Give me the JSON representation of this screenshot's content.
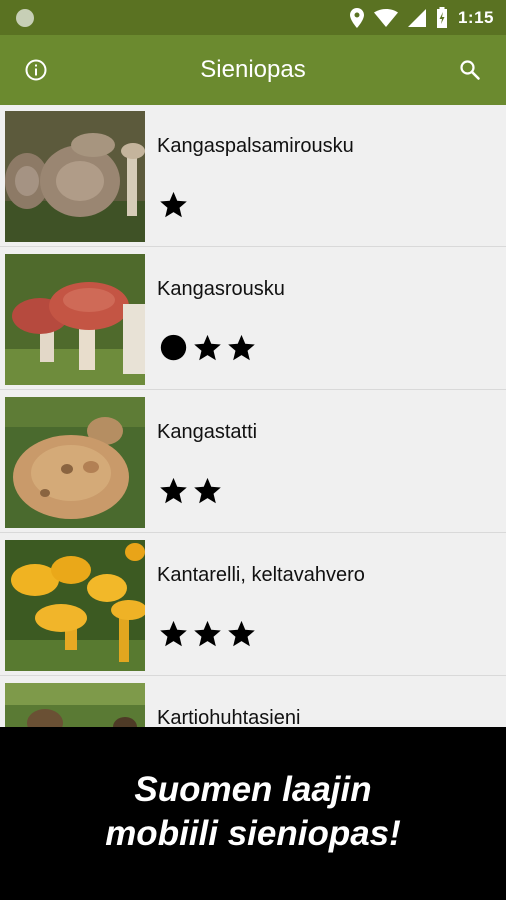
{
  "status_bar": {
    "time": "1:15",
    "icons": [
      "notification-dot-icon",
      "location-pin-icon",
      "wifi-icon",
      "cell-signal-icon",
      "battery-charging-icon"
    ]
  },
  "app_bar": {
    "title": "Sieniopas",
    "left_icon": "info-icon",
    "right_icon": "search-icon"
  },
  "list": {
    "items": [
      {
        "name": "Kangaspalsamirousku",
        "ratings": [
          "star"
        ]
      },
      {
        "name": "Kangasrousku",
        "ratings": [
          "dot",
          "star",
          "star"
        ]
      },
      {
        "name": "Kangastatti",
        "ratings": [
          "star",
          "star"
        ]
      },
      {
        "name": "Kantarelli, keltavahvero",
        "ratings": [
          "star",
          "star",
          "star"
        ]
      },
      {
        "name": "Kartiohuhtasieni",
        "ratings": []
      }
    ]
  },
  "promo": {
    "line1": "Suomen laajin",
    "line2": "mobiili sieniopas!"
  },
  "colors": {
    "status_bar": "#5a7222",
    "app_bar": "#6b8a2f",
    "list_background": "#f0f0f0",
    "promo_background": "#000000"
  }
}
